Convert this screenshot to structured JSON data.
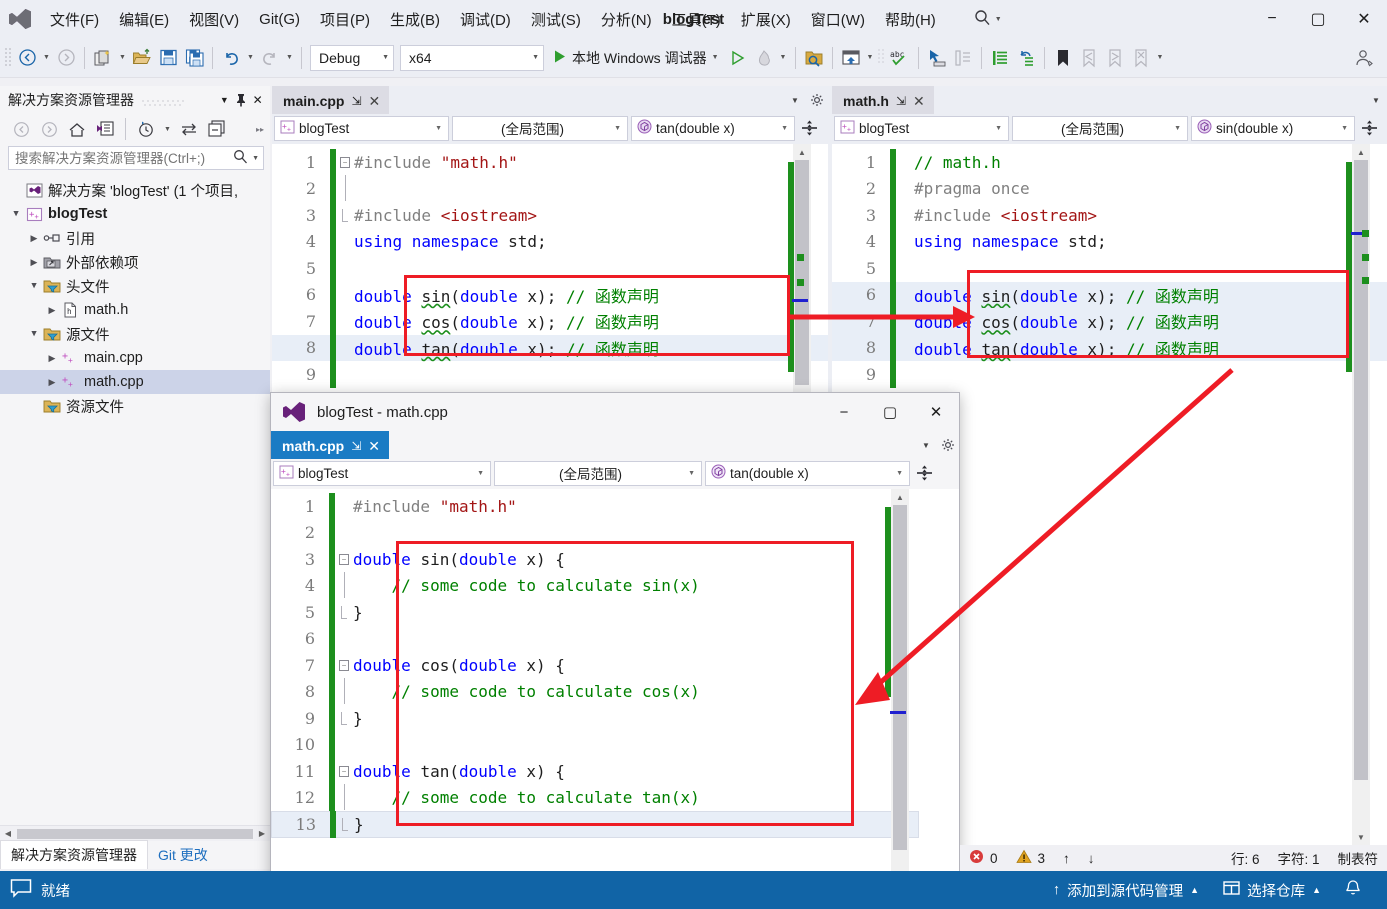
{
  "window": {
    "title": "blogTest",
    "minimize": "−",
    "maximize": "▢",
    "close": "✕"
  },
  "menu": {
    "items": [
      {
        "label": "文件(F)",
        "name": "menu-file"
      },
      {
        "label": "编辑(E)",
        "name": "menu-edit"
      },
      {
        "label": "视图(V)",
        "name": "menu-view"
      },
      {
        "label": "Git(G)",
        "name": "menu-git"
      },
      {
        "label": "项目(P)",
        "name": "menu-project"
      },
      {
        "label": "生成(B)",
        "name": "menu-build"
      },
      {
        "label": "调试(D)",
        "name": "menu-debug"
      },
      {
        "label": "测试(S)",
        "name": "menu-test"
      },
      {
        "label": "分析(N)",
        "name": "menu-analyze"
      },
      {
        "label": "工具(T)",
        "name": "menu-tools"
      },
      {
        "label": "扩展(X)",
        "name": "menu-extensions"
      },
      {
        "label": "窗口(W)",
        "name": "menu-window"
      },
      {
        "label": "帮助(H)",
        "name": "menu-help"
      }
    ]
  },
  "toolbar": {
    "config": "Debug",
    "platform": "x64",
    "run_label": "本地 Windows 调试器"
  },
  "solution_explorer": {
    "title": "解决方案资源管理器",
    "search_placeholder": "搜索解决方案资源管理器(Ctrl+;)",
    "tree": [
      {
        "label": "解决方案 'blogTest' (1 个项目,",
        "indent": 1,
        "expander": "",
        "icon": "solution-icon",
        "bold": false,
        "selected": false
      },
      {
        "label": "blogTest",
        "indent": 0,
        "expander": "▲",
        "icon": "cpp-project-icon",
        "bold": true,
        "selected": false
      },
      {
        "label": "引用",
        "indent": 1,
        "expander": "▶",
        "icon": "references-icon",
        "bold": false,
        "selected": false
      },
      {
        "label": "外部依赖项",
        "indent": 1,
        "expander": "▶",
        "icon": "external-deps-icon",
        "bold": false,
        "selected": false
      },
      {
        "label": "头文件",
        "indent": 1,
        "expander": "▲",
        "icon": "filter-folder-icon",
        "bold": false,
        "selected": false
      },
      {
        "label": "math.h",
        "indent": 2,
        "expander": "▶",
        "icon": "header-file-icon",
        "bold": false,
        "selected": false
      },
      {
        "label": "源文件",
        "indent": 1,
        "expander": "▲",
        "icon": "filter-folder-icon",
        "bold": false,
        "selected": false
      },
      {
        "label": "main.cpp",
        "indent": 2,
        "expander": "▶",
        "icon": "cpp-file-icon",
        "bold": false,
        "selected": false
      },
      {
        "label": "math.cpp",
        "indent": 2,
        "expander": "▶",
        "icon": "cpp-file-icon",
        "bold": false,
        "selected": true
      },
      {
        "label": "资源文件",
        "indent": 1,
        "expander": "",
        "icon": "filter-folder-icon",
        "bold": false,
        "selected": false
      }
    ],
    "tabs": [
      {
        "label": "解决方案资源管理器",
        "active": true
      },
      {
        "label": "Git 更改",
        "active": false
      }
    ]
  },
  "editor_main": {
    "tab": "main.cpp",
    "pin": "⇲",
    "close": "✕",
    "nav": {
      "project": "blogTest",
      "scope": "(全局范围)",
      "member": "tan(double x)"
    },
    "lines": [
      {
        "n": "1",
        "fold": "−",
        "text": "#include \"math.h\""
      },
      {
        "n": "2",
        "fold": "",
        "text": ""
      },
      {
        "n": "3",
        "fold": "",
        "text": "#include <iostream>"
      },
      {
        "n": "4",
        "fold": "",
        "text": "using namespace std;"
      },
      {
        "n": "5",
        "fold": "",
        "text": ""
      },
      {
        "n": "6",
        "fold": "",
        "text": "double sin(double x); // 函数声明"
      },
      {
        "n": "7",
        "fold": "",
        "text": "double cos(double x); // 函数声明"
      },
      {
        "n": "8",
        "fold": "",
        "text": "double tan(double x); // 函数声明"
      },
      {
        "n": "9",
        "fold": "",
        "text": ""
      }
    ]
  },
  "editor_header": {
    "tab": "math.h",
    "pin": "⇲",
    "close": "✕",
    "nav": {
      "project": "blogTest",
      "scope": "(全局范围)",
      "member": "sin(double x)"
    },
    "lines": [
      {
        "n": "1",
        "text": "// math.h"
      },
      {
        "n": "2",
        "text": "#pragma once"
      },
      {
        "n": "3",
        "text": "#include <iostream>"
      },
      {
        "n": "4",
        "text": "using namespace std;"
      },
      {
        "n": "5",
        "text": ""
      },
      {
        "n": "6",
        "text": "double sin(double x); // 函数声明"
      },
      {
        "n": "7",
        "text": "double cos(double x); // 函数声明"
      },
      {
        "n": "8",
        "text": "double tan(double x); // 函数声明"
      },
      {
        "n": "9",
        "text": ""
      }
    ]
  },
  "float_window": {
    "title": "blogTest - math.cpp",
    "minimize": "−",
    "maximize": "▢",
    "close": "✕",
    "tab": "math.cpp",
    "pin": "⇲",
    "tab_close": "✕",
    "nav": {
      "project": "blogTest",
      "scope": "(全局范围)",
      "member": "tan(double x)"
    },
    "lines": [
      {
        "n": "1",
        "fold": "",
        "text": "#include \"math.h\""
      },
      {
        "n": "2",
        "fold": "",
        "text": ""
      },
      {
        "n": "3",
        "fold": "−",
        "text": "double sin(double x) {"
      },
      {
        "n": "4",
        "fold": "",
        "text": "    // some code to calculate sin(x)"
      },
      {
        "n": "5",
        "fold": "",
        "text": "}"
      },
      {
        "n": "6",
        "fold": "",
        "text": ""
      },
      {
        "n": "7",
        "fold": "−",
        "text": "double cos(double x) {"
      },
      {
        "n": "8",
        "fold": "",
        "text": "    // some code to calculate cos(x)"
      },
      {
        "n": "9",
        "fold": "",
        "text": "}"
      },
      {
        "n": "10",
        "fold": "",
        "text": ""
      },
      {
        "n": "11",
        "fold": "−",
        "text": "double tan(double x) {"
      },
      {
        "n": "12",
        "fold": "",
        "text": "    // some code to calculate tan(x)"
      },
      {
        "n": "13",
        "fold": "",
        "text": "}"
      }
    ]
  },
  "editor_status": {
    "errors": "0",
    "warnings": "3",
    "up": "↑",
    "down": "↓",
    "line": "行: 6",
    "col": "字符: 1",
    "tabs_mode": "制表符"
  },
  "statusbar": {
    "ready": "就绪",
    "source_control": "添加到源代码管理",
    "repo": "选择仓库",
    "bell": "🔔",
    "caret_up": "▲"
  },
  "colors": {
    "accent_blue": "#1164a6",
    "annotation_red": "#ee1c25",
    "change_green": "#1d8f1d",
    "keyword": "#0000ff",
    "string": "#a31515",
    "comment": "#008000",
    "preproc": "#808080"
  }
}
